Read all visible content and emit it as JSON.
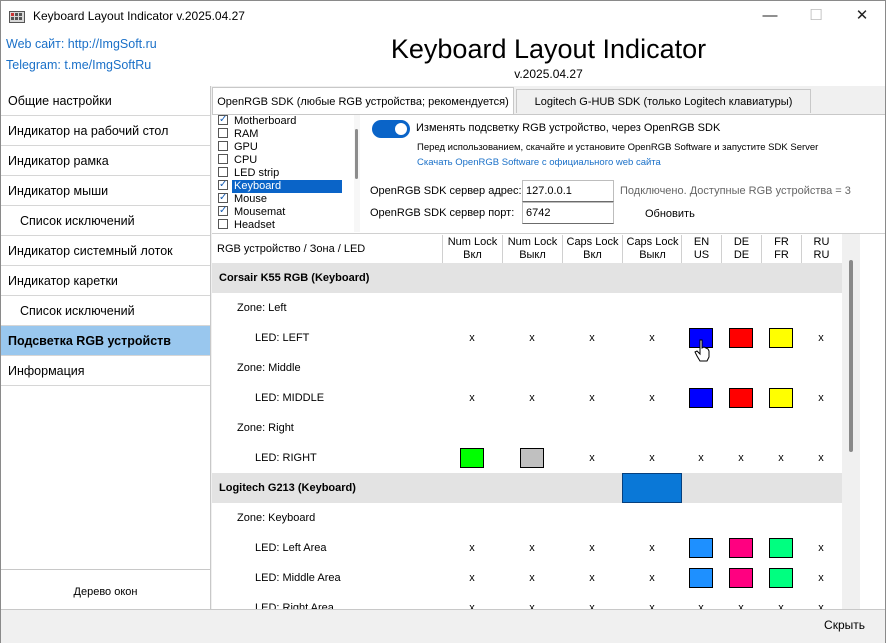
{
  "window": {
    "title": "Keyboard Layout Indicator v.2025.04.27",
    "minimize": "—",
    "maximize": "☐",
    "close": "✕"
  },
  "header": {
    "web_link": "Web сайт: http://ImgSoft.ru",
    "telegram_link": "Telegram: t.me/ImgSoftRu",
    "app_title": "Keyboard Layout Indicator",
    "app_version": "v.2025.04.27"
  },
  "sidebar": {
    "items": [
      {
        "label": "Общие настройки"
      },
      {
        "label": "Индикатор на рабочий стол"
      },
      {
        "label": "Индикатор рамка"
      },
      {
        "label": "Индикатор мыши"
      },
      {
        "label": "Список исключений"
      },
      {
        "label": "Индикатор системный лоток"
      },
      {
        "label": "Индикатор каретки"
      },
      {
        "label": "Список исключений"
      },
      {
        "label": "Подсветка RGB устройств"
      },
      {
        "label": "Информация"
      }
    ],
    "tree_button": "Дерево окон"
  },
  "tabs": [
    {
      "label": "OpenRGB SDK (любые RGB устройства; рекомендуется)"
    },
    {
      "label": "Logitech G-HUB SDK (только Logitech клавиатуры)"
    }
  ],
  "devices": [
    {
      "label": "Motherboard",
      "checked": true
    },
    {
      "label": "RAM",
      "checked": false
    },
    {
      "label": "GPU",
      "checked": false
    },
    {
      "label": "CPU",
      "checked": false
    },
    {
      "label": "LED strip",
      "checked": false
    },
    {
      "label": "Keyboard",
      "checked": true
    },
    {
      "label": "Mouse",
      "checked": true
    },
    {
      "label": "Mousemat",
      "checked": true
    },
    {
      "label": "Headset",
      "checked": false
    }
  ],
  "openrgb": {
    "toggle_label": "Изменять подсветку RGB устройство, через OpenRGB SDK",
    "hint": "Перед использованием, скачайте и установите OpenRGB Software и запустите SDK Server",
    "download_link": "Скачать OpenRGB Software с официального web сайта",
    "server_address_label": "OpenRGB SDK сервер адрес:",
    "server_address_value": "127.0.0.1",
    "server_port_label": "OpenRGB SDK сервер порт:",
    "server_port_value": "6742",
    "status": "Подключено. Доступные RGB устройства = 3",
    "refresh_button": "Обновить"
  },
  "table": {
    "first_col": "RGB устройство / Зона / LED",
    "columns": [
      {
        "l1": "Num Lock",
        "l2": "Вкл"
      },
      {
        "l1": "Num Lock",
        "l2": "Выкл"
      },
      {
        "l1": "Caps Lock",
        "l2": "Вкл"
      },
      {
        "l1": "Caps Lock",
        "l2": "Выкл"
      },
      {
        "l1": "EN",
        "l2": "US"
      },
      {
        "l1": "DE",
        "l2": "DE"
      },
      {
        "l1": "FR",
        "l2": "FR"
      },
      {
        "l1": "RU",
        "l2": "RU"
      }
    ],
    "rows": [
      {
        "type": "group",
        "label": "Corsair K55 RGB (Keyboard)"
      },
      {
        "type": "zone",
        "label": "Zone: Left"
      },
      {
        "type": "led",
        "label": "LED: LEFT",
        "cells": [
          "x",
          "x",
          "x",
          "x",
          "#0000ff",
          "#ff0000",
          "#ffff00",
          "x"
        ]
      },
      {
        "type": "zone",
        "label": "Zone: Middle"
      },
      {
        "type": "led",
        "label": "LED: MIDDLE",
        "cells": [
          "x",
          "x",
          "x",
          "x",
          "#0000ff",
          "#ff0000",
          "#ffff00",
          "x"
        ]
      },
      {
        "type": "zone",
        "label": "Zone: Right"
      },
      {
        "type": "led",
        "label": "LED: RIGHT",
        "cells": [
          "#00ff00",
          "#c0c0c0",
          "x",
          "x",
          "x",
          "x",
          "x",
          "x"
        ]
      },
      {
        "type": "group",
        "label": "Logitech G213 (Keyboard)"
      },
      {
        "type": "zone",
        "label": "Zone: Keyboard"
      },
      {
        "type": "led",
        "label": "LED: Left Area",
        "cells": [
          "x",
          "x",
          "x",
          "x",
          "#1e90ff",
          "#ff0080",
          "#00ff80",
          "x"
        ]
      },
      {
        "type": "led",
        "label": "LED: Middle Area",
        "cells": [
          "x",
          "x",
          "x",
          "x",
          "#1e90ff",
          "#ff0080",
          "#00ff80",
          "x"
        ]
      },
      {
        "type": "led",
        "label": "LED: Right Area",
        "cells": [
          "x",
          "x",
          "x",
          "x",
          "x",
          "x",
          "x",
          "x"
        ]
      }
    ]
  },
  "footer": {
    "close_button": "Скрыть"
  },
  "colors": {
    "accent": "#0a64c8",
    "sidebar_active": "#99c7ee",
    "link": "#1a70c8",
    "group_row": "#e3e3e3",
    "highlighted_cell": "#0a78d7"
  }
}
